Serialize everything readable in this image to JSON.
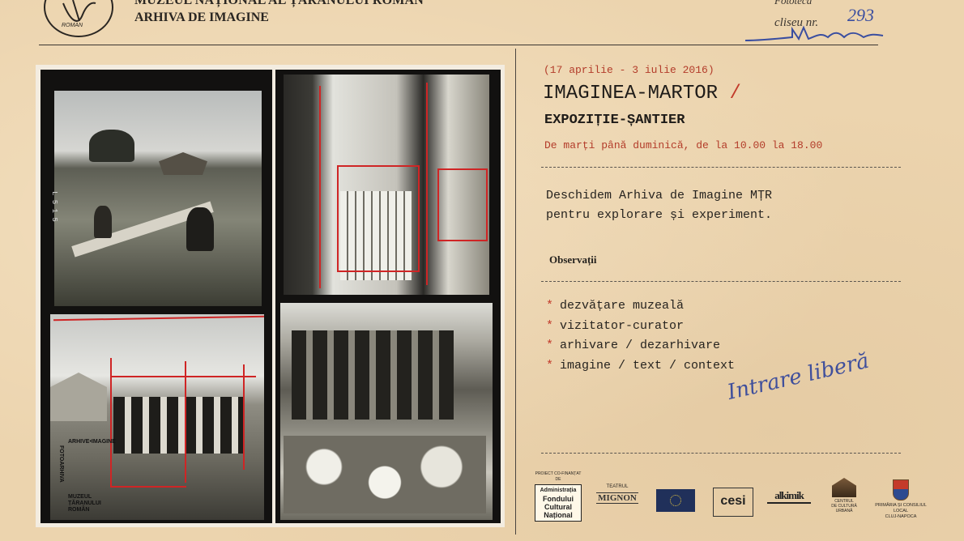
{
  "header": {
    "museum_name": "MUZEUL NAȚIONAL AL ȚĂRANULUI ROMÂN",
    "archive_name": "ARHIVA DE IMAGINE",
    "logo_label": "ROMAN",
    "fototeca_label": "Fototeca",
    "cliseu_label": "cliseu nr.",
    "cliseu_number": "293",
    "signature_text": "MuZeu"
  },
  "photos": {
    "stamp_vertical": "FOTOARHIVA",
    "stamp_arc": "ARHIVE•IMAGINE",
    "stamp_line1": "MUZEUL",
    "stamp_line2": "ȚĂRANULUI",
    "stamp_line3": "ROMÂN",
    "frame1_edge": "L 5 1 5"
  },
  "event": {
    "dates": "(17 aprilie - 3 iulie 2016)",
    "title_main": "IMAGINEA-MARTOR",
    "title_slash": "/",
    "subtitle": "EXPOZIȚIE-ȘANTIER",
    "hours": "De marți până duminică, de la 10.00 la 18.00",
    "intro_line1": "Deschidem Arhiva de Imagine MȚR",
    "intro_line2": "pentru explorare și experiment.",
    "observations_label": "Observații",
    "bullets": [
      "dezvățare muzeală",
      "vizitator-curator",
      "arhivare / dezarhivare",
      "imagine / text / context"
    ],
    "bullet_symbol": "*",
    "free_entry": "Intrare liberă"
  },
  "sponsors": {
    "afcn_header": "PROIECT CO-FINANȚAT DE",
    "afcn_line1": "Administrația",
    "afcn_line2": "Fondului",
    "afcn_line3": "Cultural",
    "afcn_line4": "Național",
    "mignon_line1": "TEATRUL",
    "mignon_line2": "MIGNON",
    "cesi": "cesi",
    "alkemik": "alkimik",
    "tranzit_line1": "CENTRUL",
    "tranzit_line2": "DE CULTURĂ",
    "tranzit_line3": "URBANĂ",
    "primaria_line1": "PRIMĂRIA ȘI CONSILIUL LOCAL",
    "primaria_line2": "CLUJ-NAPOCA"
  },
  "colors": {
    "paper": "#ecd4ae",
    "ink": "#26231f",
    "accent_red": "#c23a2a",
    "handwriting_blue": "#3f4f9c"
  }
}
